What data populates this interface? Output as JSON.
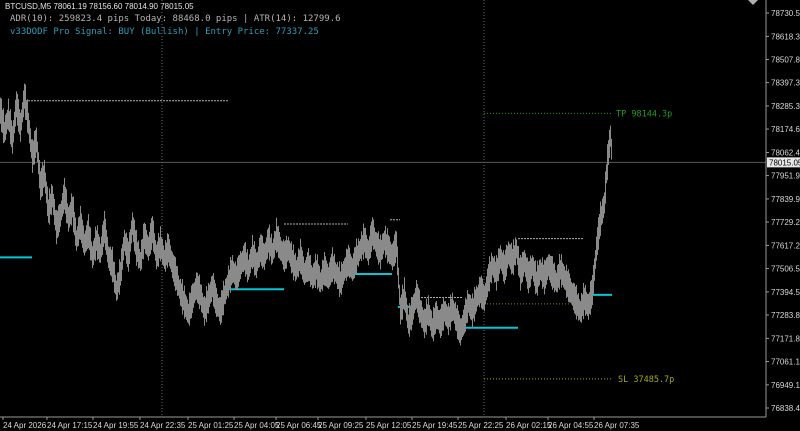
{
  "header": {
    "symbol_info": "BTCUSD,M5  78061.19 78156.60 78014.90 78015.05",
    "stats_line": "ADR(10): 259823.4 pips   Today: 88468.0 pips | ATR(14): 12799.6",
    "signal_line": "v33DODF Pro Signal: BUY (Bullish) | Entry Price: 77337.25"
  },
  "price_axis": {
    "ticks": [
      78730.55,
      78618.3,
      78507.8,
      78397.3,
      78285.3,
      78174.6,
      78062.4,
      77951.9,
      77839.9,
      77729.2,
      77617.2,
      77506.5,
      77394.5,
      77283.8,
      77171.8,
      77061.1,
      76949.1,
      76838.4
    ],
    "tick_labels": [
      "78730.55",
      "78618.30",
      "78507.80",
      "78397.30",
      "78285.30",
      "78174.60",
      "78062.40",
      "77951.90",
      "77839.90",
      "77729.20",
      "77617.20",
      "77506.50",
      "77394.50",
      "77283.80",
      "77171.80",
      "77061.10",
      "76949.10",
      "76838.40"
    ],
    "current_price": 78015.05,
    "current_price_label": "78015.05"
  },
  "time_axis": {
    "labels": [
      "24 Apr 2026",
      "24 Apr 17:15",
      "24 Apr 19:55",
      "24 Apr 22:35",
      "25 Apr 01:25",
      "25 Apr 04:05",
      "25 Apr 06:45",
      "25 Apr 09:25",
      "25 Apr 12:05",
      "25 Apr 19:45",
      "25 Apr 22:25",
      "26 Apr 02:15",
      "26 Apr 04:55",
      "26 Apr 07:35"
    ]
  },
  "levels": {
    "tp_label": "TP 98144.3p",
    "sl_label": "SL 37485.7p"
  },
  "colors": {
    "background": "#000000",
    "candles": "#8a8a8a",
    "support_lines": "#00c8d8",
    "resistance_lines": "#b0b0b0",
    "tp_line": "#1f9c1f",
    "sl_line": "#a8a81a",
    "entry_line": "#8a8a1a",
    "grid_line": "#6a6a6a",
    "axis_text": "#d8d8d8"
  },
  "chart_data": {
    "type": "candlestick",
    "title": "BTCUSD,M5",
    "x_labels": [
      "24 Apr 2026",
      "24 Apr 17:15",
      "24 Apr 19:55",
      "24 Apr 22:35",
      "25 Apr 01:25",
      "25 Apr 04:05",
      "25 Apr 06:45",
      "25 Apr 09:25",
      "25 Apr 12:05",
      "25 Apr 19:45",
      "25 Apr 22:25",
      "26 Apr 02:15",
      "26 Apr 04:55",
      "26 Apr 07:35"
    ],
    "ylim": [
      76800,
      78800
    ],
    "close_path": [
      [
        0,
        78260
      ],
      [
        4,
        78160
      ],
      [
        8,
        78240
      ],
      [
        12,
        78120
      ],
      [
        16,
        78290
      ],
      [
        20,
        78180
      ],
      [
        24,
        78330
      ],
      [
        28,
        78200
      ],
      [
        32,
        78040
      ],
      [
        36,
        78120
      ],
      [
        40,
        77900
      ],
      [
        44,
        77960
      ],
      [
        48,
        77780
      ],
      [
        52,
        77850
      ],
      [
        56,
        77700
      ],
      [
        60,
        77760
      ],
      [
        64,
        77860
      ],
      [
        68,
        77740
      ],
      [
        72,
        77800
      ],
      [
        76,
        77640
      ],
      [
        80,
        77720
      ],
      [
        84,
        77620
      ],
      [
        88,
        77680
      ],
      [
        92,
        77560
      ],
      [
        96,
        77640
      ],
      [
        100,
        77580
      ],
      [
        104,
        77700
      ],
      [
        108,
        77560
      ],
      [
        112,
        77520
      ],
      [
        116,
        77400
      ],
      [
        120,
        77480
      ],
      [
        124,
        77640
      ],
      [
        128,
        77560
      ],
      [
        132,
        77720
      ],
      [
        136,
        77600
      ],
      [
        140,
        77540
      ],
      [
        144,
        77660
      ],
      [
        148,
        77600
      ],
      [
        152,
        77690
      ],
      [
        156,
        77560
      ],
      [
        160,
        77620
      ],
      [
        164,
        77550
      ],
      [
        168,
        77600
      ],
      [
        172,
        77520
      ],
      [
        176,
        77460
      ],
      [
        180,
        77390
      ],
      [
        184,
        77340
      ],
      [
        188,
        77290
      ],
      [
        192,
        77360
      ],
      [
        196,
        77420
      ],
      [
        200,
        77380
      ],
      [
        204,
        77300
      ],
      [
        208,
        77360
      ],
      [
        212,
        77420
      ],
      [
        216,
        77340
      ],
      [
        220,
        77300
      ],
      [
        224,
        77380
      ],
      [
        228,
        77440
      ],
      [
        232,
        77500
      ],
      [
        236,
        77460
      ],
      [
        240,
        77520
      ],
      [
        244,
        77560
      ],
      [
        248,
        77500
      ],
      [
        252,
        77580
      ],
      [
        256,
        77520
      ],
      [
        260,
        77600
      ],
      [
        264,
        77560
      ],
      [
        268,
        77640
      ],
      [
        272,
        77580
      ],
      [
        276,
        77660
      ],
      [
        280,
        77600
      ],
      [
        284,
        77560
      ],
      [
        288,
        77600
      ],
      [
        292,
        77540
      ],
      [
        296,
        77500
      ],
      [
        300,
        77560
      ],
      [
        304,
        77480
      ],
      [
        308,
        77520
      ],
      [
        312,
        77460
      ],
      [
        316,
        77500
      ],
      [
        320,
        77440
      ],
      [
        324,
        77500
      ],
      [
        328,
        77460
      ],
      [
        332,
        77520
      ],
      [
        336,
        77480
      ],
      [
        340,
        77440
      ],
      [
        344,
        77500
      ],
      [
        348,
        77540
      ],
      [
        352,
        77500
      ],
      [
        356,
        77560
      ],
      [
        360,
        77600
      ],
      [
        364,
        77640
      ],
      [
        368,
        77580
      ],
      [
        372,
        77680
      ],
      [
        376,
        77620
      ],
      [
        380,
        77580
      ],
      [
        384,
        77640
      ],
      [
        388,
        77600
      ],
      [
        392,
        77560
      ],
      [
        396,
        77620
      ],
      [
        400,
        77300
      ],
      [
        404,
        77380
      ],
      [
        408,
        77240
      ],
      [
        412,
        77300
      ],
      [
        416,
        77380
      ],
      [
        420,
        77300
      ],
      [
        424,
        77240
      ],
      [
        428,
        77300
      ],
      [
        432,
        77220
      ],
      [
        436,
        77280
      ],
      [
        440,
        77240
      ],
      [
        444,
        77300
      ],
      [
        448,
        77260
      ],
      [
        452,
        77320
      ],
      [
        456,
        77260
      ],
      [
        460,
        77200
      ],
      [
        464,
        77260
      ],
      [
        468,
        77340
      ],
      [
        472,
        77300
      ],
      [
        476,
        77360
      ],
      [
        480,
        77400
      ],
      [
        484,
        77360
      ],
      [
        488,
        77460
      ],
      [
        492,
        77520
      ],
      [
        496,
        77480
      ],
      [
        500,
        77560
      ],
      [
        504,
        77500
      ],
      [
        508,
        77580
      ],
      [
        512,
        77540
      ],
      [
        516,
        77600
      ],
      [
        520,
        77480
      ],
      [
        524,
        77540
      ],
      [
        528,
        77460
      ],
      [
        532,
        77520
      ],
      [
        536,
        77440
      ],
      [
        540,
        77500
      ],
      [
        544,
        77460
      ],
      [
        548,
        77520
      ],
      [
        552,
        77480
      ],
      [
        556,
        77440
      ],
      [
        560,
        77500
      ],
      [
        564,
        77460
      ],
      [
        568,
        77420
      ],
      [
        572,
        77380
      ],
      [
        576,
        77340
      ],
      [
        580,
        77300
      ],
      [
        584,
        77360
      ],
      [
        588,
        77320
      ],
      [
        592,
        77400
      ],
      [
        596,
        77600
      ],
      [
        600,
        77740
      ],
      [
        604,
        77820
      ],
      [
        606,
        77960
      ],
      [
        608,
        78060
      ],
      [
        610,
        78140
      ],
      [
        612,
        78015
      ]
    ],
    "support_levels": [
      {
        "x_start": 0,
        "x_end": 32,
        "price": 77560
      },
      {
        "x_start": 228,
        "x_end": 284,
        "price": 77407
      },
      {
        "x_start": 348,
        "x_end": 392,
        "price": 77480
      },
      {
        "x_start": 398,
        "x_end": 420,
        "price": 77323
      },
      {
        "x_start": 462,
        "x_end": 518,
        "price": 77223
      },
      {
        "x_start": 584,
        "x_end": 612,
        "price": 77380
      }
    ],
    "resistance_levels": [
      {
        "x_start": 28,
        "x_end": 228,
        "price": 78310
      },
      {
        "x_start": 284,
        "x_end": 348,
        "price": 77720
      },
      {
        "x_start": 390,
        "x_end": 400,
        "price": 77740
      },
      {
        "x_start": 418,
        "x_end": 462,
        "price": 77368
      },
      {
        "x_start": 518,
        "x_end": 584,
        "price": 77650
      }
    ],
    "tp_price": 78250,
    "sl_price": 76978,
    "entry_price": 77337.25,
    "current_price": 78015.05
  }
}
